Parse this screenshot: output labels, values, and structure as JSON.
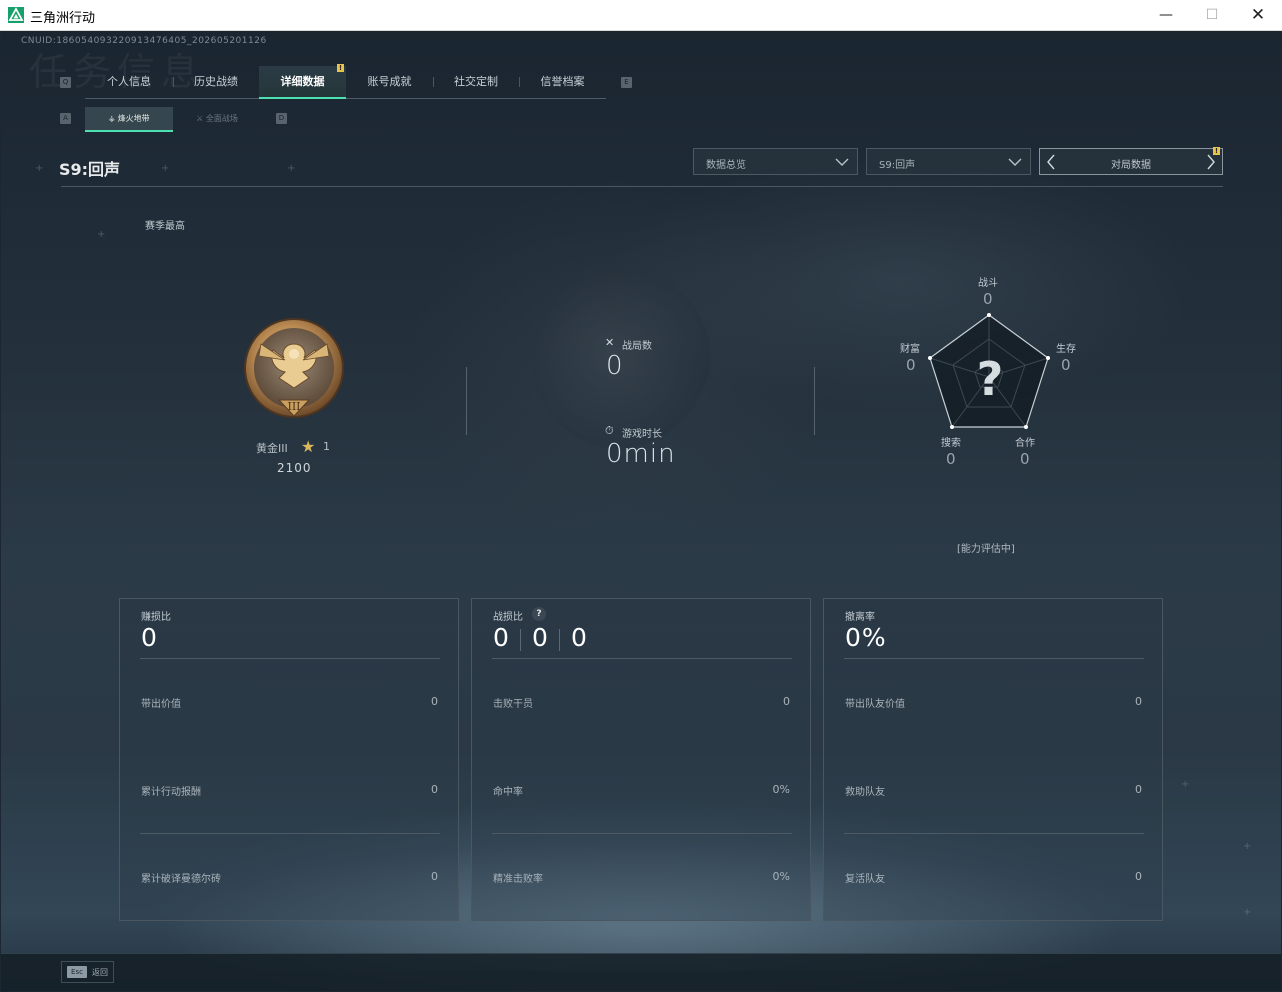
{
  "window": {
    "title": "三角洲行动",
    "min": "—",
    "max": "☐",
    "close": "✕"
  },
  "cnuid": "CNUID:1860540932209134764​05_202605201126",
  "bg_title": "任务信息",
  "keys": {
    "prev_tab": "Q",
    "next_tab": "E",
    "prev_sub": "A",
    "next_sub": "D"
  },
  "tabs": [
    {
      "label": "个人信息"
    },
    {
      "label": "历史战绩"
    },
    {
      "label": "详细数据"
    },
    {
      "label": "账号成就"
    },
    {
      "label": "社交定制"
    },
    {
      "label": "信誉档案"
    }
  ],
  "notice_mark": "!",
  "subtabs": [
    {
      "label": "烽火地带",
      "icon": "⚶"
    },
    {
      "label": "全面战场",
      "icon": "⚔"
    }
  ],
  "season": {
    "title": "S9:回声"
  },
  "filters": {
    "overview": "数据总览",
    "season": "S9:回声",
    "match_data": "对局数据"
  },
  "season_high": "赛季最高",
  "rank": {
    "name": "黄金III",
    "stars": "1",
    "score": "2100",
    "numeral": "III"
  },
  "stats": {
    "matches_label": "战局数",
    "matches_value": "0",
    "playtime_label": "游戏时长",
    "playtime_value": "0min"
  },
  "radar": {
    "combat_label": "战斗",
    "combat_value": "0",
    "survival_label": "生存",
    "survival_value": "0",
    "coop_label": "合作",
    "coop_value": "0",
    "search_label": "搜索",
    "search_value": "0",
    "wealth_label": "财富",
    "wealth_value": "0",
    "unknown": "?",
    "status": "[能力评估中]"
  },
  "panels": [
    {
      "title": "赚损比",
      "big": "0",
      "rows": [
        {
          "label": "带出价值",
          "value": "0"
        },
        {
          "label": "累计行动报酬",
          "value": "0"
        },
        {
          "label": "累计破译曼德尔砖",
          "value": "0"
        }
      ]
    },
    {
      "title": "战损比",
      "help": "?",
      "kd": [
        "0",
        "0",
        "0"
      ],
      "rows": [
        {
          "label": "击败干员",
          "value": "0"
        },
        {
          "label": "命中率",
          "value": "0%"
        },
        {
          "label": "精准击败率",
          "value": "0%"
        }
      ]
    },
    {
      "title": "撤离率",
      "big": "0%",
      "rows": [
        {
          "label": "带出队友价值",
          "value": "0"
        },
        {
          "label": "救助队友",
          "value": "0"
        },
        {
          "label": "复活队友",
          "value": "0"
        }
      ]
    }
  ],
  "footer": {
    "esc_key": "Esc",
    "esc_label": "返回"
  },
  "colors": {
    "accent": "#4de0b0",
    "notice": "#e9c44a",
    "medal_gold": "#c9a060"
  }
}
